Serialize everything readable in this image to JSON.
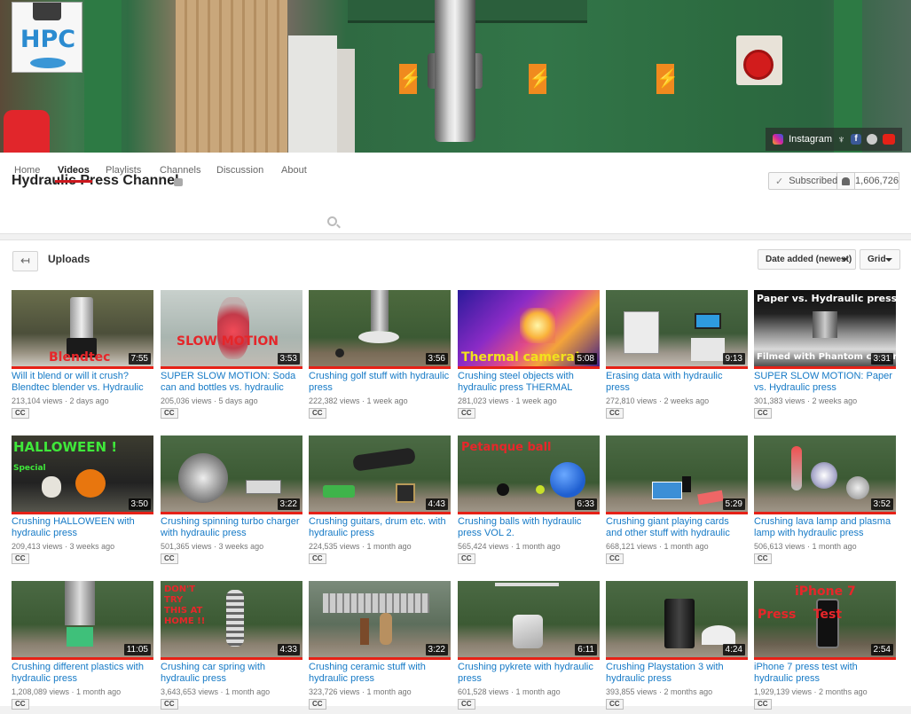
{
  "channel": {
    "logo_text": "HPC",
    "name": "Hydraulic Press Channel",
    "subscribe_label": "Subscribed",
    "subscriber_count": "1,606,726",
    "social_link_label": "Instagram"
  },
  "tabs": [
    "Home",
    "Videos",
    "Playlists",
    "Channels",
    "Discussion",
    "About"
  ],
  "uploads": {
    "title": "Uploads",
    "sort_label": "Date added (newest)",
    "view_label": "Grid"
  },
  "videos": [
    {
      "title": "Will it blend or will it crush? Blendtec blender vs. Hydraulic press",
      "views": "213,104 views",
      "age": "2 days ago",
      "duration": "7:55",
      "overlay": "Blendtec",
      "cc": "CC"
    },
    {
      "title": "SUPER SLOW MOTION: Soda can and bottles vs. hydraulic press",
      "views": "205,036 views",
      "age": "5 days ago",
      "duration": "3:53",
      "overlay": "SLOW      MOTION",
      "cc": "CC"
    },
    {
      "title": "Crushing golf stuff with hydraulic press",
      "views": "222,382 views",
      "age": "1 week ago",
      "duration": "3:56",
      "overlay": "",
      "cc": "CC"
    },
    {
      "title": "Crushing steel objects with hydraulic press THERMAL CAMERA",
      "views": "281,023 views",
      "age": "1 week ago",
      "duration": "5:08",
      "overlay": "Thermal camera!",
      "cc": "CC"
    },
    {
      "title": "Erasing data with hydraulic press",
      "views": "272,810 views",
      "age": "2 weeks ago",
      "duration": "9:13",
      "overlay": "",
      "cc": "CC"
    },
    {
      "title": "SUPER SLOW MOTION: Paper vs. Hydraulic press",
      "views": "301,383 views",
      "age": "2 weeks ago",
      "duration": "3:31",
      "overlay": "Paper vs. Hydraulic press",
      "overlay2": "Filmed with Phantom camera!",
      "cc": "CC"
    },
    {
      "title": "Crushing HALLOWEEN with hydraulic press",
      "views": "209,413 views",
      "age": "3 weeks ago",
      "duration": "3:50",
      "overlay": "HALLOWEEN !",
      "overlay2": "Special",
      "cc": "CC"
    },
    {
      "title": "Crushing spinning turbo charger with hydraulic press",
      "views": "501,365 views",
      "age": "3 weeks ago",
      "duration": "3:22",
      "overlay": "",
      "cc": "CC"
    },
    {
      "title": "Crushing guitars, drum etc. with hydraulic press",
      "views": "224,535 views",
      "age": "1 month ago",
      "duration": "4:43",
      "overlay": "",
      "cc": "CC"
    },
    {
      "title": "Crushing balls with hydraulic press VOL 2.",
      "views": "565,424 views",
      "age": "1 month ago",
      "duration": "6:33",
      "overlay": "Petanque ball",
      "cc": "CC"
    },
    {
      "title": "Crushing giant playing cards and other stuff with hydraulic press",
      "views": "668,121 views",
      "age": "1 month ago",
      "duration": "5:29",
      "overlay": "",
      "cc": "CC"
    },
    {
      "title": "Crushing lava lamp and plasma lamp with hydraulic press",
      "views": "506,613 views",
      "age": "1 month ago",
      "duration": "3:52",
      "overlay": "",
      "cc": "CC"
    },
    {
      "title": "Crushing different plastics with hydraulic press",
      "views": "1,208,089 views",
      "age": "1 month ago",
      "duration": "11:05",
      "overlay": "",
      "cc": "CC"
    },
    {
      "title": "Crushing car spring with hydraulic press",
      "views": "3,643,653 views",
      "age": "1 month ago",
      "duration": "4:33",
      "overlay": "DON'T TRY THIS AT HOME !!",
      "cc": "CC"
    },
    {
      "title": "Crushing ceramic stuff with hydraulic press",
      "views": "323,726 views",
      "age": "1 month ago",
      "duration": "3:22",
      "overlay": "",
      "cc": "CC"
    },
    {
      "title": "Crushing pykrete with hydraulic press",
      "views": "601,528 views",
      "age": "1 month ago",
      "duration": "6:11",
      "overlay": "",
      "cc": "CC"
    },
    {
      "title": "Crushing Playstation 3 with hydraulic press",
      "views": "393,855 views",
      "age": "2 months ago",
      "duration": "4:24",
      "overlay": "",
      "cc": "CC"
    },
    {
      "title": "iPhone 7 press test with hydraulic press",
      "views": "1,929,139 views",
      "age": "2 months ago",
      "duration": "2:54",
      "overlay": "iPhone 7",
      "overlay2": "Press    Test",
      "cc": "CC"
    }
  ],
  "colors": {
    "accent": "#cc181e",
    "link": "#167ac6",
    "progress": "#e62117",
    "press_green": "#2d7a44"
  }
}
